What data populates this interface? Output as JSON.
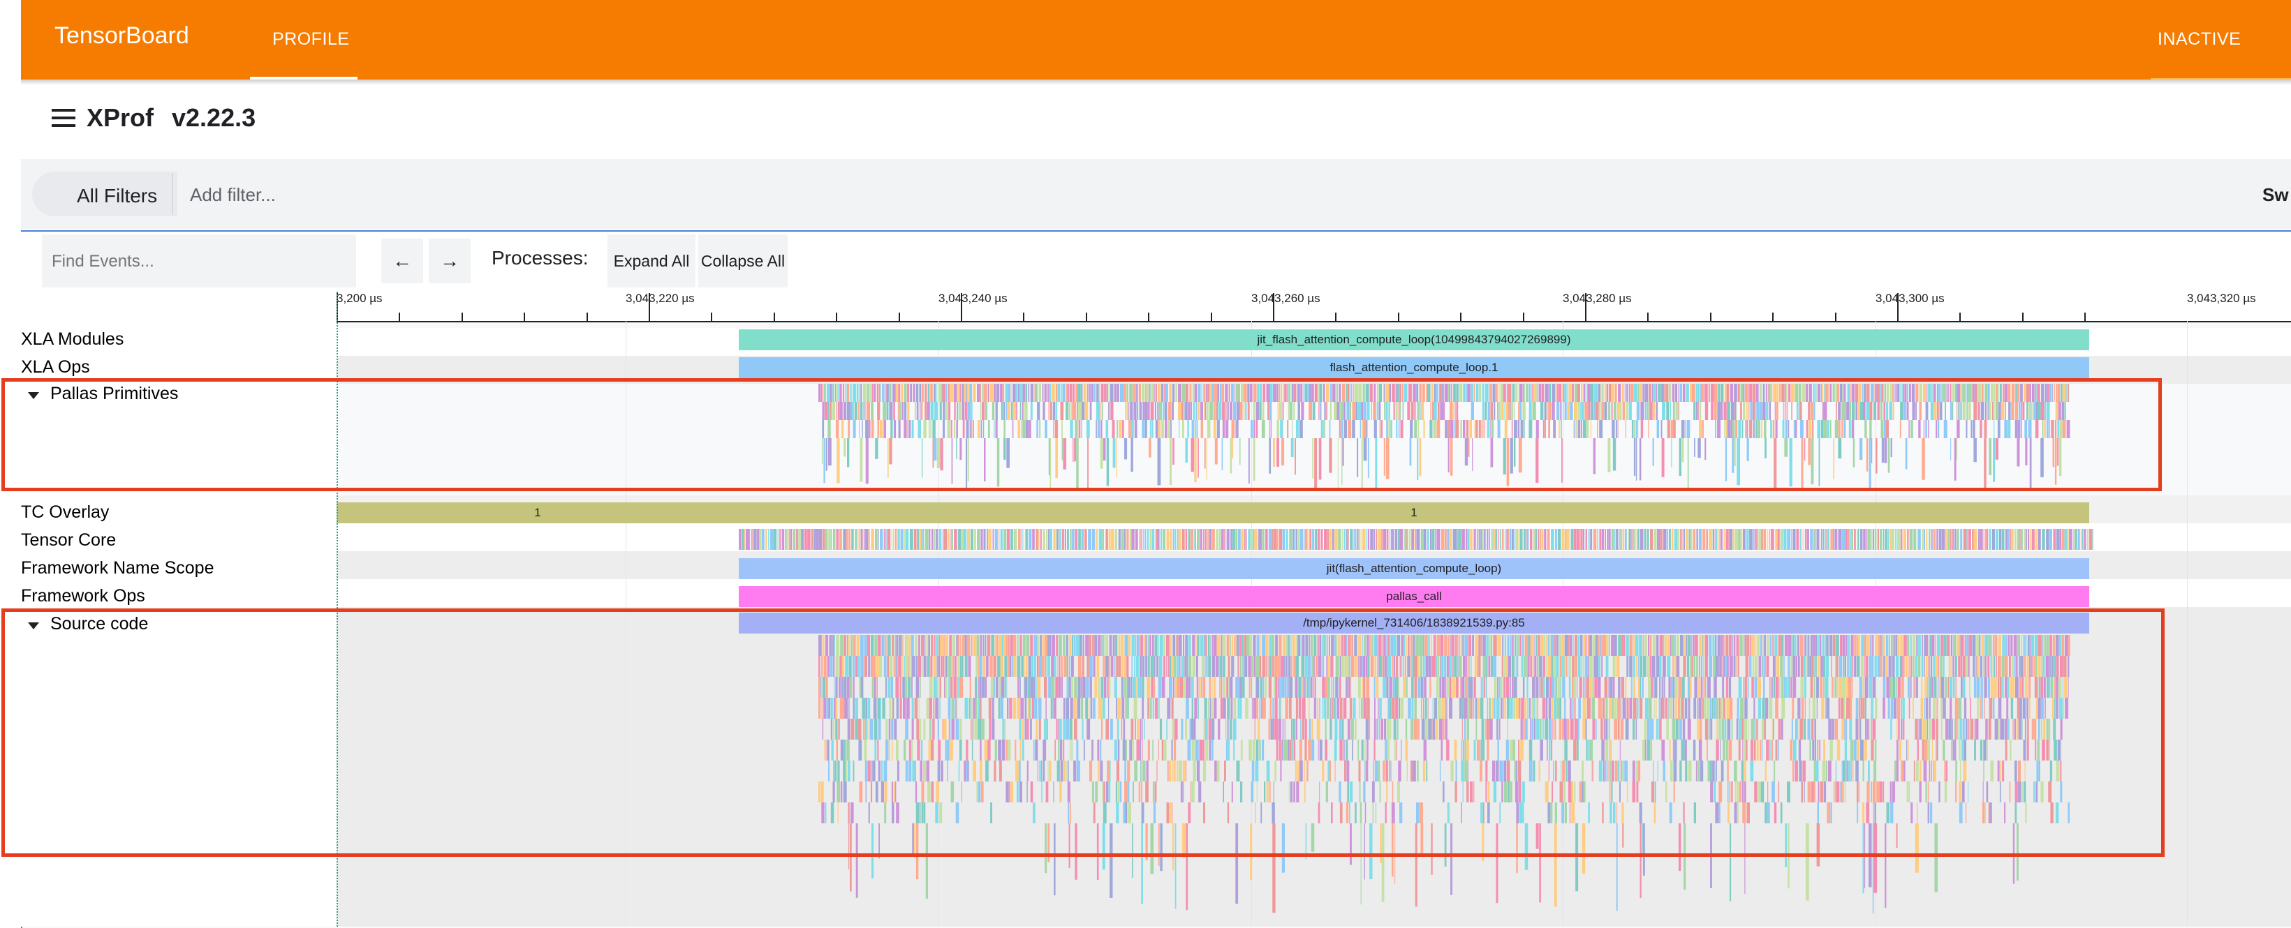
{
  "app": {
    "brand": "TensorBoard",
    "active_tab": "PROFILE",
    "inactive_tab": "INACTIVE",
    "tool_name": "XProf",
    "version": "v2.22.3"
  },
  "filters": {
    "all_filters_label": "All Filters",
    "add_filter_placeholder": "Add filter...",
    "right_button_label": "Sw"
  },
  "toolbar": {
    "find_placeholder": "Find Events...",
    "prev_label": "←",
    "next_label": "→",
    "processes_label": "Processes:",
    "expand_all_label": "Expand All",
    "collapse_all_label": "Collapse All"
  },
  "timeline": {
    "tick_labels": [
      "3,200 µs",
      "3,043,220 µs",
      "3,043,240 µs",
      "3,043,260 µs",
      "3,043,280 µs",
      "3,043,300 µs",
      "3,043,320 µs"
    ]
  },
  "tracks": {
    "xla_modules": {
      "label": "XLA Modules",
      "event": "jit_flash_attention_compute_loop(10499843794027269899)"
    },
    "xla_ops": {
      "label": "XLA Ops",
      "event": "flash_attention_compute_loop.1"
    },
    "pallas_primitives": {
      "label": "Pallas Primitives"
    },
    "tc_overlay": {
      "label": "TC Overlay",
      "event_left": "1",
      "event_main": "1"
    },
    "tensor_core": {
      "label": "Tensor Core"
    },
    "framework_name_scope": {
      "label": "Framework Name Scope",
      "event": "jit(flash_attention_compute_loop)"
    },
    "framework_ops": {
      "label": "Framework Ops",
      "event": "pallas_call"
    },
    "source_code": {
      "label": "Source code",
      "event": "/tmp/ipykernel_731406/1838921539.py:85"
    }
  },
  "colors": {
    "appbar": "#f57c00",
    "xla_modules_bar": "#80deca",
    "xla_ops_bar": "#90c8f8",
    "tc_overlay_bar": "#c4c47c",
    "name_scope_bar": "#9ec2fa",
    "framework_ops_bar": "#ff7cf0",
    "source_code_bar": "#a4b0f5",
    "highlight_box": "#e53d1f"
  }
}
